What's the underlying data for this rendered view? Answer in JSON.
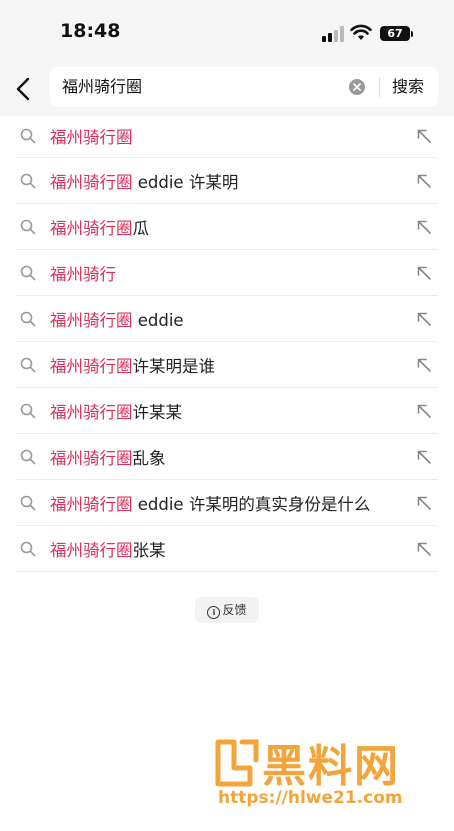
{
  "status_bar": {
    "time": "18:48",
    "battery": "67"
  },
  "search": {
    "query": "福州骑行圈",
    "button_label": "搜索"
  },
  "suggestions": [
    {
      "highlight": "福州骑行圈",
      "rest": ""
    },
    {
      "highlight": "福州骑行圈",
      "rest": " eddie 许某明"
    },
    {
      "highlight": "福州骑行圈",
      "rest": "瓜"
    },
    {
      "highlight": "福州骑行",
      "rest": ""
    },
    {
      "highlight": "福州骑行圈",
      "rest": " eddie"
    },
    {
      "highlight": "福州骑行圈",
      "rest": "许某明是谁"
    },
    {
      "highlight": "福州骑行圈",
      "rest": "许某某"
    },
    {
      "highlight": "福州骑行圈",
      "rest": "乱象"
    },
    {
      "highlight": "福州骑行圈",
      "rest": " eddie 许某明的真实身份是什么"
    },
    {
      "highlight": "福州骑行圈",
      "rest": "张某"
    }
  ],
  "feedback": {
    "icon": "i",
    "label": "反馈"
  },
  "watermark": {
    "brand": "黑料网",
    "url": "https://hlwe21.com"
  },
  "colors": {
    "highlight": "#d8315b",
    "watermark": "#f3a43a"
  }
}
